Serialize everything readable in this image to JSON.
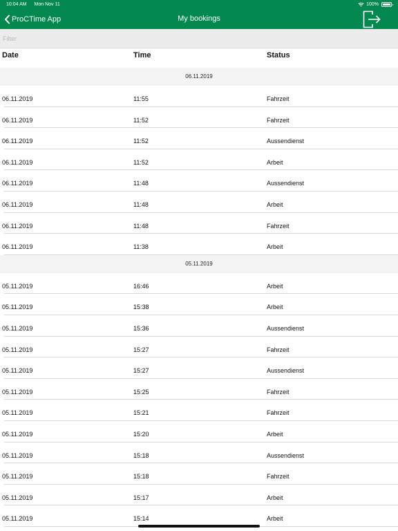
{
  "status_bar": {
    "time": "10:04 AM",
    "date": "Mon Nov 11",
    "battery": "100%",
    "wifi_icon": "wifi-icon",
    "battery_icon": "battery-icon"
  },
  "nav": {
    "back_label": "ProCTime App",
    "title": "My bookings",
    "back_icon": "chevron-left-icon",
    "logout_icon": "logout-icon"
  },
  "filter": {
    "placeholder": "Filter",
    "value": ""
  },
  "columns": {
    "date": "Date",
    "time": "Time",
    "status": "Status"
  },
  "colors": {
    "brand": "#03894f",
    "section_bg": "#f4f4f4",
    "filter_bg": "#ececec"
  },
  "sections": [
    {
      "header": "06.11.2019",
      "rows": [
        {
          "date": "06.11.2019",
          "time": "11:55",
          "status": "Fahrzeit"
        },
        {
          "date": "06.11.2019",
          "time": "11:52",
          "status": "Fahrzeit"
        },
        {
          "date": "06.11.2019",
          "time": "11:52",
          "status": "Aussendienst"
        },
        {
          "date": "06.11.2019",
          "time": "11:52",
          "status": "Arbeit"
        },
        {
          "date": "06.11.2019",
          "time": "11:48",
          "status": "Aussendienst"
        },
        {
          "date": "06.11.2019",
          "time": "11:48",
          "status": "Arbeit"
        },
        {
          "date": "06.11.2019",
          "time": "11:48",
          "status": "Fahrzeit"
        },
        {
          "date": "06.11.2019",
          "time": "11:38",
          "status": "Arbeit"
        }
      ]
    },
    {
      "header": "05.11.2019",
      "rows": [
        {
          "date": "05.11.2019",
          "time": "16:46",
          "status": "Arbeit"
        },
        {
          "date": "05.11.2019",
          "time": "15:38",
          "status": "Arbeit"
        },
        {
          "date": "05.11.2019",
          "time": "15:36",
          "status": "Aussendienst"
        },
        {
          "date": "05.11.2019",
          "time": "15:27",
          "status": "Fahrzeit"
        },
        {
          "date": "05.11.2019",
          "time": "15:27",
          "status": "Aussendienst"
        },
        {
          "date": "05.11.2019",
          "time": "15:25",
          "status": "Fahrzeit"
        },
        {
          "date": "05.11.2019",
          "time": "15:21",
          "status": "Fahrzeit"
        },
        {
          "date": "05.11.2019",
          "time": "15:20",
          "status": "Arbeit"
        },
        {
          "date": "05.11.2019",
          "time": "15:18",
          "status": "Aussendienst"
        },
        {
          "date": "05.11.2019",
          "time": "15:18",
          "status": "Fahrzeit"
        },
        {
          "date": "05.11.2019",
          "time": "15:17",
          "status": "Arbeit"
        },
        {
          "date": "05.11.2019",
          "time": "15:14",
          "status": "Arbeit"
        }
      ]
    }
  ]
}
